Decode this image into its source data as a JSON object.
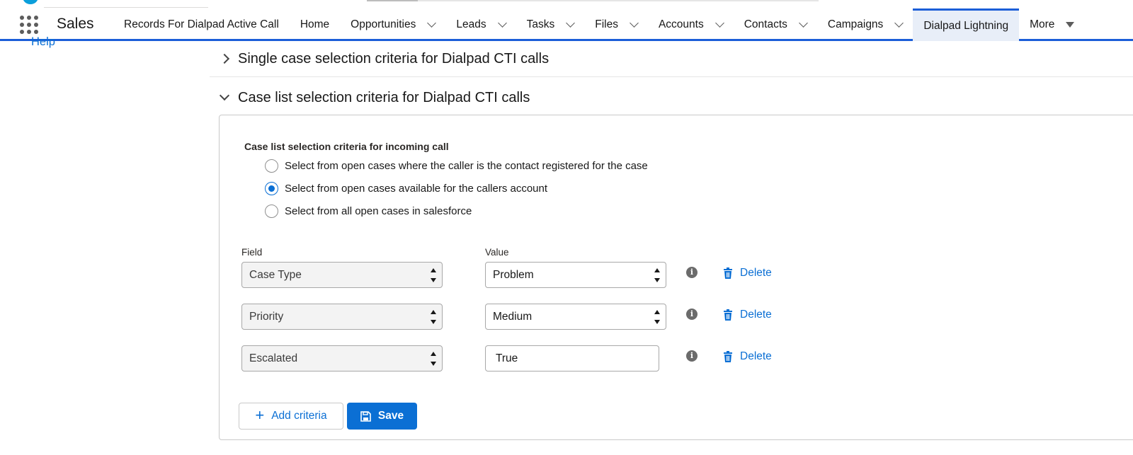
{
  "app": {
    "name": "Sales"
  },
  "nav": {
    "items": [
      {
        "label": "Records For Dialpad Active Call",
        "dropdown": false
      },
      {
        "label": "Home",
        "dropdown": false
      },
      {
        "label": "Opportunities",
        "dropdown": true
      },
      {
        "label": "Leads",
        "dropdown": true
      },
      {
        "label": "Tasks",
        "dropdown": true
      },
      {
        "label": "Files",
        "dropdown": true
      },
      {
        "label": "Accounts",
        "dropdown": true
      },
      {
        "label": "Contacts",
        "dropdown": true
      },
      {
        "label": "Campaigns",
        "dropdown": true
      },
      {
        "label": "Dialpad Lightning",
        "dropdown": false,
        "active": true
      }
    ],
    "more_label": "More"
  },
  "help_link": "Help",
  "sections": {
    "single": {
      "title": "Single case selection criteria for Dialpad CTI calls",
      "expanded": false
    },
    "list": {
      "title": "Case list selection criteria for Dialpad CTI calls",
      "expanded": true
    }
  },
  "panel": {
    "label": "Case list selection criteria for incoming call",
    "radio_options": [
      {
        "label": "Select from open cases where the caller is the contact registered for the case",
        "checked": false
      },
      {
        "label": "Select from open cases available for the callers account",
        "checked": true
      },
      {
        "label": "Select from all open cases in salesforce",
        "checked": false
      }
    ],
    "field_header": "Field",
    "value_header": "Value",
    "criteria": [
      {
        "field": "Case Type",
        "value": "Problem",
        "value_type": "select"
      },
      {
        "field": "Priority",
        "value": "Medium",
        "value_type": "select"
      },
      {
        "field": "Escalated",
        "value": "True",
        "value_type": "input"
      }
    ],
    "delete_label": "Delete",
    "add_label": "Add criteria",
    "save_label": "Save"
  },
  "colors": {
    "brand_blue": "#0b6fd4",
    "nav_underline": "#1b5ed8"
  }
}
